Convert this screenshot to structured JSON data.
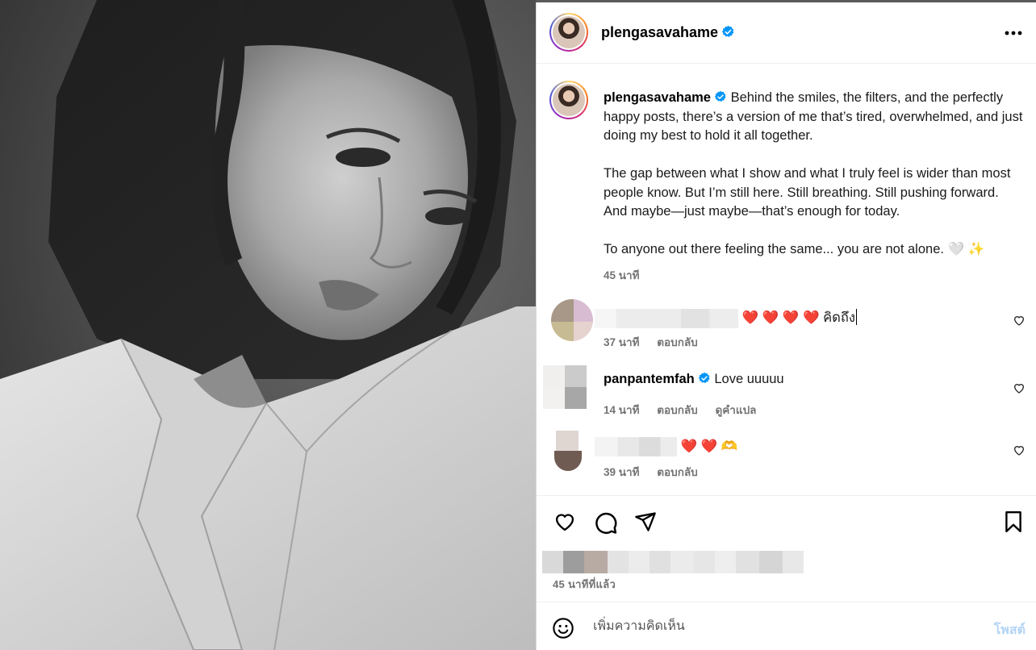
{
  "post": {
    "username": "plengasavahame",
    "more_icon": "more-horizontal-icon",
    "caption": [
      "Behind the smiles, the filters, and the perfectly happy posts, there’s a version of me that’s tired, overwhelmed, and just doing my best to hold it all together.",
      "The gap between what I show and what I truly feel is wider than most people know. But I’m still here. Still breathing. Still pushing forward. And maybe—just maybe—that’s enough for today.",
      "To anyone out there feeling the same... you are not alone. 🤍 ✨"
    ],
    "caption_time": "45 นาที"
  },
  "comments": [
    {
      "username": "",
      "text": "❤️ ❤️ ❤️ ❤️ คิดถึง",
      "time": "37 นาที",
      "reply": "ตอบกลับ",
      "translate": ""
    },
    {
      "username": "panpantemfah",
      "text": "Love uuuuu",
      "time": "14 นาที",
      "reply": "ตอบกลับ",
      "translate": "ดูคำแปล"
    },
    {
      "username": "",
      "text": "❤️ ❤️ 🫶",
      "time": "39 นาที",
      "reply": "ตอบกลับ",
      "translate": ""
    }
  ],
  "actions": {
    "like_icon": "heart-icon",
    "comment_icon": "comment-icon",
    "share_icon": "send-icon",
    "save_icon": "bookmark-icon",
    "post_time": "45 นาทีที่แล้ว"
  },
  "composer": {
    "placeholder": "เพิ่มความคิดเห็น",
    "post_label": "โพสต์"
  },
  "colors": {
    "verified": "#0095f6",
    "meta_text": "#737373",
    "post_button_disabled": "#b3d4f5"
  }
}
